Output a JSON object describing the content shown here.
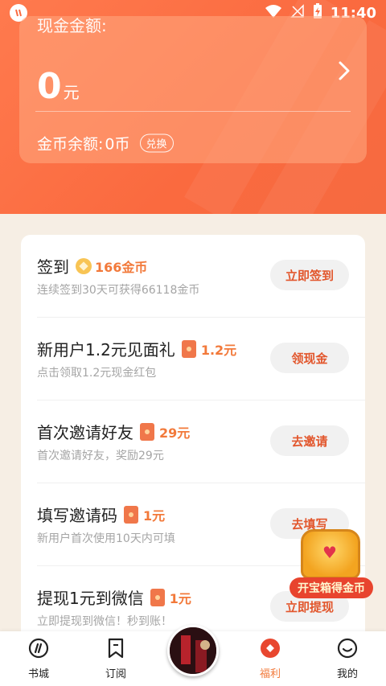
{
  "status_bar": {
    "time": "11:40"
  },
  "cash_card": {
    "label": "现金金额:",
    "amount": "0",
    "unit": "元",
    "coin_label": "金币余额:",
    "coin_value": "0币",
    "exchange_label": "兑换"
  },
  "tasks": [
    {
      "title": "签到",
      "reward": "166金币",
      "reward_icon": "gold-coin-icon",
      "desc": "连续签到30天可获得66118金币",
      "action": "立即签到"
    },
    {
      "title": "新用户1.2元见面礼",
      "reward": "1.2元",
      "reward_icon": "red-packet-icon",
      "desc": "点击领取1.2元现金红包",
      "action": "领现金"
    },
    {
      "title": "首次邀请好友",
      "reward": "29元",
      "reward_icon": "red-packet-icon",
      "desc": "首次邀请好友，奖励29元",
      "action": "去邀请"
    },
    {
      "title": "填写邀请码",
      "reward": "1元",
      "reward_icon": "red-packet-icon",
      "desc": "新用户首次使用10天内可填",
      "action": "去填写"
    },
    {
      "title": "提现1元到微信",
      "reward": "1元",
      "reward_icon": "red-packet-icon",
      "desc": "立即提现到微信！秒到账！",
      "action": "立即提现"
    }
  ],
  "treasure": {
    "label": "开宝箱得金币"
  },
  "tab_bar": {
    "items": [
      {
        "label": "书城",
        "icon": "bookstore-icon"
      },
      {
        "label": "订阅",
        "icon": "bookmark-icon"
      },
      {
        "label": "福利",
        "icon": "welfare-icon",
        "active": true
      },
      {
        "label": "我的",
        "icon": "profile-icon"
      }
    ]
  },
  "colors": {
    "accent": "#f2793a",
    "header": "#fa6a3f",
    "button_text": "#e2562c"
  }
}
